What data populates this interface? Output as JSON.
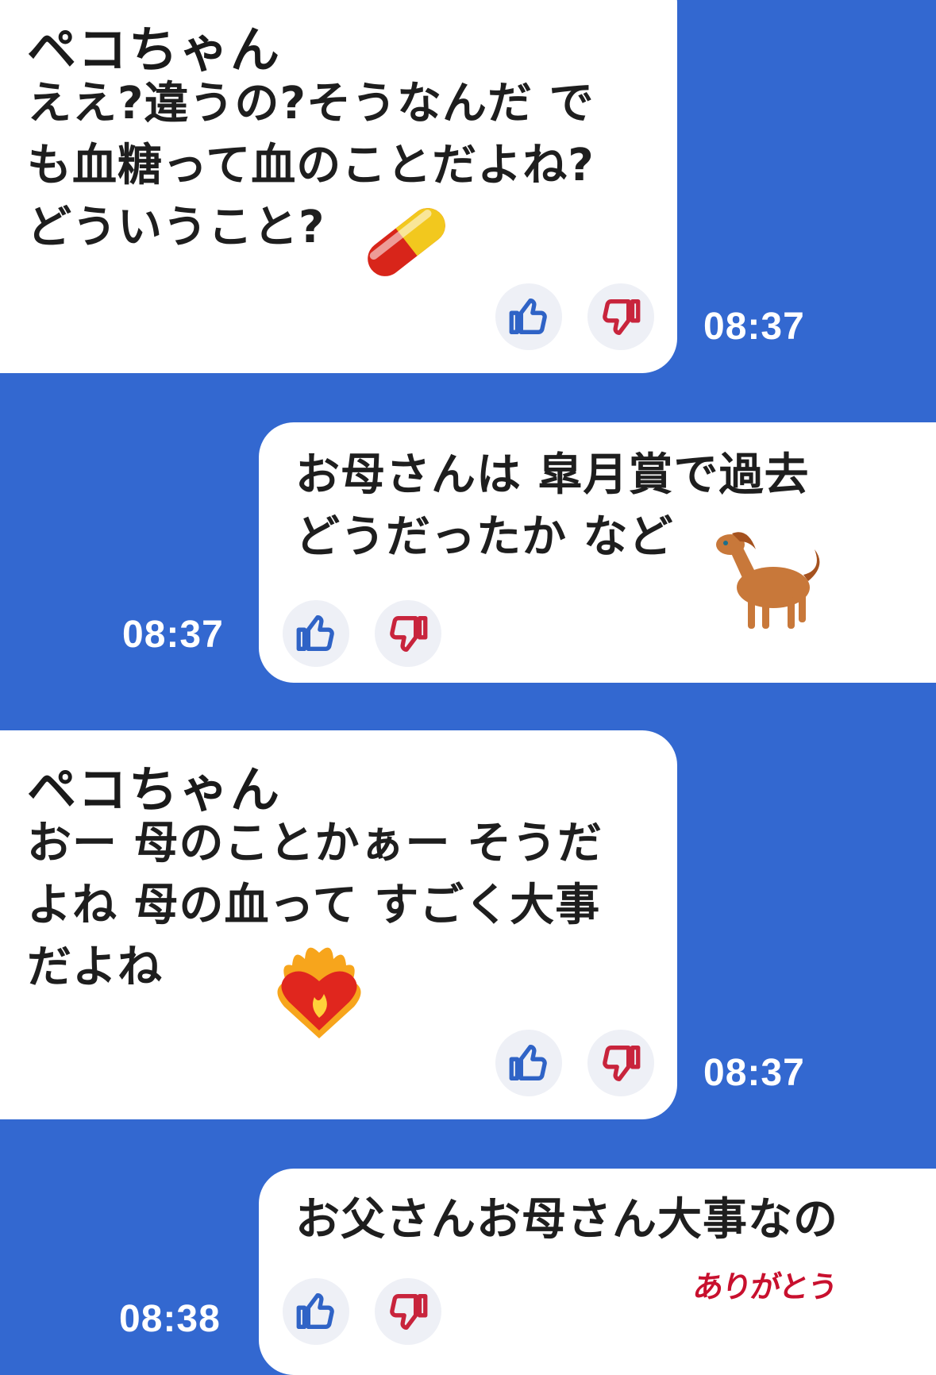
{
  "colors": {
    "background": "#3368d0",
    "bubble": "#ffffff",
    "like": "#2f63c6",
    "dislike": "#c8243c"
  },
  "messages": [
    {
      "side": "incoming",
      "sender": "ペコちゃん",
      "text": "ええ?違うの?そうなんだ で\nも血糖って血のことだよね?\nどういうこと?",
      "sticker": "pill-emoji",
      "time": "08:37"
    },
    {
      "side": "outgoing",
      "text": "お母さんは 皐月賞で過去\nどうだったか など",
      "sticker": "horse-emoji",
      "time": "08:37"
    },
    {
      "side": "incoming",
      "sender": "ペコちゃん",
      "text": "おー 母のことかぁー そうだ\nよね 母の血って すごく大事\nだよね",
      "sticker": "heart-on-fire-emoji",
      "time": "08:37"
    },
    {
      "side": "outgoing",
      "text": "お父さんお母さん大事なの",
      "sticker": "arigatou-sticker",
      "sticker_text": "ありがとう",
      "time": "08:38"
    }
  ]
}
